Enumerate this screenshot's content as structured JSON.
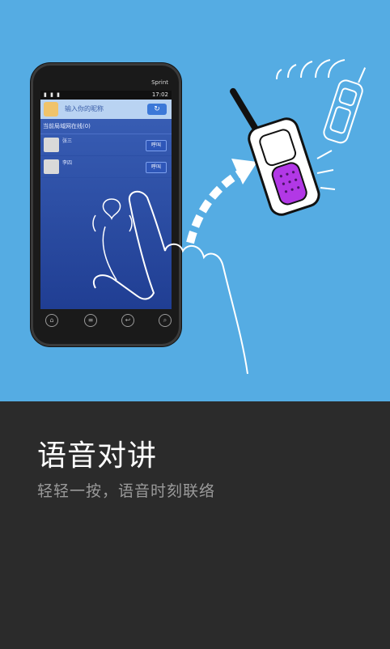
{
  "feature": {
    "title": "语音对讲",
    "subtitle": "轻轻一按，语音时刻联络"
  },
  "phone": {
    "brand": "Sprint",
    "status_time": "17:02",
    "nickname_placeholder": "输入你的昵称",
    "refresh_icon": "refresh-icon",
    "online_label": "当前局域网在线(0)",
    "contacts": [
      {
        "name": "张三",
        "call_label": "呼叫"
      },
      {
        "name": "李四",
        "call_label": "呼叫"
      }
    ]
  },
  "colors": {
    "hero_bg": "#55ace3",
    "panel_bg": "#2b2b2b",
    "title": "#ffffff",
    "subtitle": "#9a9a9a"
  }
}
